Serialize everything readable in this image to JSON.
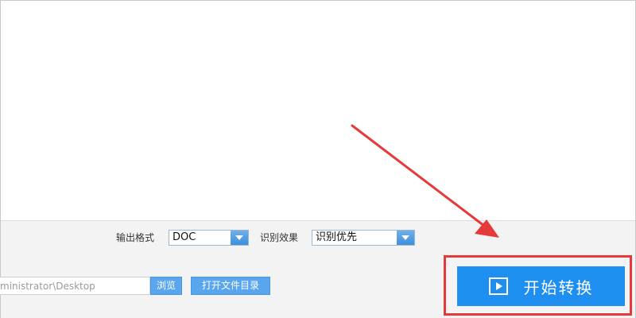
{
  "options": {
    "output_format_label": "输出格式",
    "output_format_value": "DOC",
    "recognition_label": "识别效果",
    "recognition_value": "识别优先"
  },
  "path": {
    "value": "ministrator\\Desktop",
    "browse_label": "浏览",
    "open_dir_label": "打开文件目录"
  },
  "start": {
    "label": "开始转换",
    "icon": "play-icon"
  },
  "annotation": {
    "arrow_color": "#e53a3a",
    "highlight_color": "#e53a3a",
    "icon": "arrow-annotation"
  }
}
